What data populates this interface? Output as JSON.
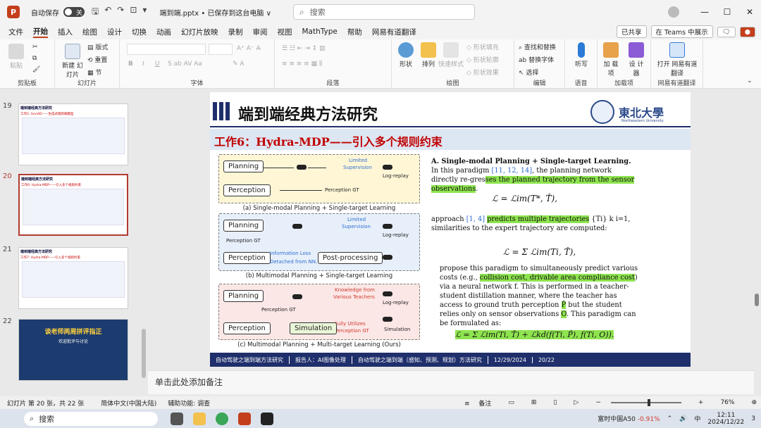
{
  "titlebar": {
    "autosave": "自动保存",
    "toggle": "关",
    "filename": "端到端.pptx • 已保存到这台电脑 ∨",
    "search_placeholder": "搜索"
  },
  "menu": {
    "items": [
      "文件",
      "开始",
      "插入",
      "绘图",
      "设计",
      "切换",
      "动画",
      "幻灯片放映",
      "录制",
      "审阅",
      "视图",
      "MathType",
      "帮助",
      "网易有道翻译"
    ],
    "right": [
      "已共享",
      "在 Teams 中展示"
    ]
  },
  "ribbon": {
    "groups": [
      "剪贴板",
      "幻灯片",
      "字体",
      "段落",
      "绘图",
      "编辑",
      "语音",
      "加载项",
      "网易有道翻译"
    ],
    "paste": "粘贴",
    "new_slide": "新建\n幻灯片",
    "layout": "版式",
    "reset": "重置",
    "section": "节",
    "shape": "形状",
    "arrange": "排列",
    "quick_style": "快速样式",
    "fill": "形状填充",
    "outline": "形状轮廓",
    "effects": "形状效果",
    "find": "查找和替换",
    "replace": "替换字体",
    "select": "选择",
    "dictate": "听写",
    "addin": "加\n载项",
    "designer": "设\n计器",
    "translate": "打开\n网易有道翻译"
  },
  "thumbs": [
    {
      "num": "19",
      "title": "端到端经典方法研究",
      "sub": "工作5: GenAD——生成式端到端模型"
    },
    {
      "num": "20",
      "title": "端到端经典方法研究",
      "sub": "工作6: Hydra-MDP——引入多个规则约束"
    },
    {
      "num": "21",
      "title": "端到端经典方法研究",
      "sub": "工作7: Hydra-MDP——引入多个规则约束"
    },
    {
      "num": "22",
      "c1": "谈老师两周拼评指正",
      "c2": "欢迎批评与讨论"
    }
  ],
  "slide": {
    "title": "端到端经典方法研究",
    "logo": "東北大學",
    "logo_sub": "Northeastern University",
    "subtitle": "工作6：Hydra-MDP——引入多个规则约束",
    "diag_a": {
      "planning": "Planning",
      "perception": "Perception",
      "limited": "Limited",
      "supervision": "Supervision",
      "logreplay": "Log-replay",
      "pgt": "Perception GT",
      "caption": "(a) Single-modal Planning + Single-target Learning"
    },
    "diag_b": {
      "planning": "Planning",
      "perception": "Perception",
      "pgt": "Perception GT",
      "limited": "Limited",
      "supervision": "Supervision",
      "logreplay": "Log-replay",
      "info": "Information Loss",
      "detached": "Detached from NN.",
      "post": "Post-processing",
      "caption": "(b) Multimodal Planning + Single-target Learning"
    },
    "diag_c": {
      "planning": "Planning",
      "perception": "Perception",
      "pgt": "Perception GT",
      "knowledge": "Knowledge from",
      "teachers": "Various Teachers",
      "fully": "Fully Utilizes",
      "pgt2": "Perception GT",
      "simulation": "Simulation",
      "logreplay": "Log-replay",
      "sim_right": "Simulation",
      "caption": "(c) Multimodal Planning + Multi-target Learning (Ours)"
    },
    "text": {
      "h": "A. Single-modal Planning + Single-target Learning.",
      "p1a": " In this paradigm ",
      "p1refs": "[11, 12, 14]",
      "p1b": ", the planning network directly re-gres",
      "p1hl": "ses the planned trajectory from the sensor observations",
      "eq1": "ℒ = ℒim(T*, T̂),",
      "p2a": "approach ",
      "p2refs": "[1, 4]",
      "p2hl": "predicts multiple trajectories",
      "p2b": " {Ti} k i=1,",
      "p3": "similarities to the expert trajectory are computed:",
      "eq2": "ℒ = Σ ℒim(Ti, T̂),",
      "p4a": "propose this paradigm to simultaneously predict various costs (e.g., ",
      "p4hl": "collision cost, drivable area compliance cost",
      "p4b": ") via a neural network f. This is performed in a teacher-student distillation manner, where the teacher has access to ground truth perception ",
      "p4c": "P̂",
      "p4d": " but the student relies only on sensor observations ",
      "p4e": "O",
      "p4f": ". This paradigm can be formulated as:",
      "eq3": "ℒ = Σ ℒim(Ti, T̂) + ℒkd(f(Ti, P̂), f(Ti, O))."
    },
    "footer": [
      "自动驾驶之端到端方法研究",
      "报告人：AI图像处理",
      "自动驾驶之端到端（感知、预测、规划）方法研究",
      "12/29/2024",
      "20/22"
    ]
  },
  "notes": "单击此处添加备注",
  "status": {
    "slide": "幻灯片 第 20 张，共 22 张",
    "lang": "简体中文(中国大陆)",
    "access": "辅助功能: 调查",
    "notes": "备注",
    "zoom": "76%"
  },
  "taskbar": {
    "search": "搜索",
    "stock": "富时中国A50",
    "change": "-0.91%",
    "time": "12:11",
    "date": "2024/12/22",
    "ime": "中",
    "badge": "3"
  }
}
